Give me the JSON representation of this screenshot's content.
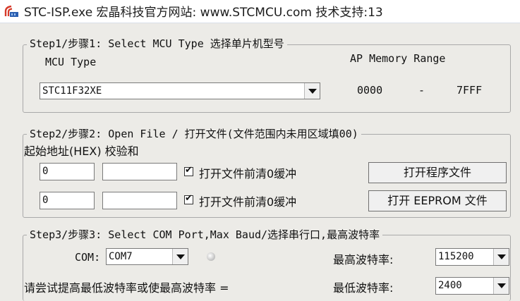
{
  "window": {
    "title": "STC-ISP.exe   宏晶科技官方网站: www.STCMCU.com  技术支持:13"
  },
  "step1": {
    "legend": "Step1/步骤1: Select MCU Type  选择单片机型号",
    "mcu_type_label": "MCU Type",
    "mcu_type_value": "STC11F32XE",
    "ap_memory_label": "AP Memory Range",
    "ap_start": "0000",
    "ap_dash": "-",
    "ap_end": "7FFF"
  },
  "step2": {
    "legend": "Step2/步骤2: Open File / 打开文件(文件范围内未用区域填00)",
    "start_addr_label": "起始地址(HEX) 校验和",
    "row1": {
      "addr": "0",
      "checksum": "",
      "clear_label": "打开文件前清0缓冲",
      "checked": true,
      "button": "打开程序文件"
    },
    "row2": {
      "addr": "0",
      "checksum": "",
      "clear_label": "打开文件前清0缓冲",
      "checked": true,
      "button": "打开 EEPROM 文件"
    }
  },
  "step3": {
    "legend": "Step3/步骤3: Select COM Port,Max Baud/选择串行口,最高波特率",
    "com_label": "COM:",
    "com_value": "COM7",
    "max_baud_label": "最高波特率:",
    "max_baud_value": "115200",
    "hint": "请尝试提高最低波特率或使最高波特率 =",
    "min_baud_label": "最低波特率:",
    "min_baud_value": "2400"
  },
  "colors": {
    "window_bg": "#ecebe7",
    "titlebar_bg": "#ffffff",
    "border": "#a9a9a9"
  },
  "icons": {
    "app": "stc-isp-app-icon",
    "status": "led-indicator-icon"
  }
}
